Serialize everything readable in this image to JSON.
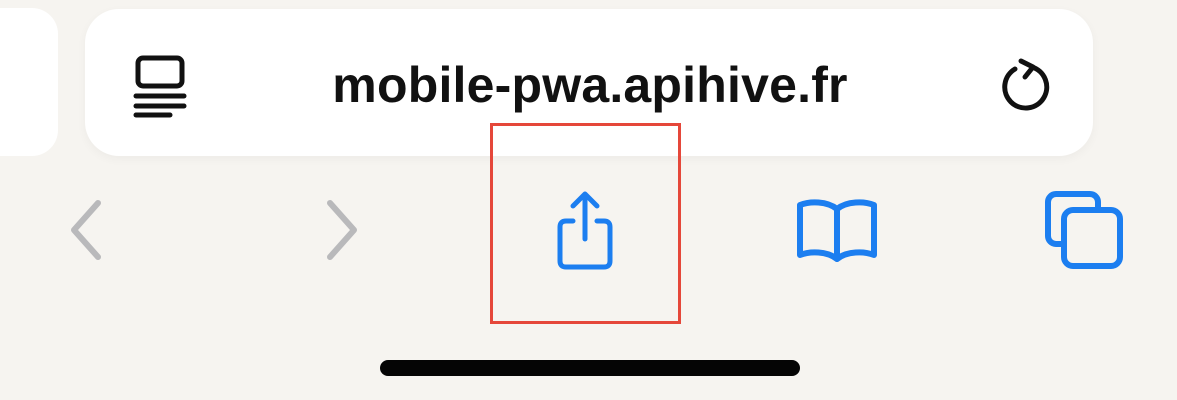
{
  "address_bar": {
    "url": "mobile-pwa.apihive.fr",
    "reader_icon": "reader-page-icon",
    "reload_icon": "reload-icon"
  },
  "toolbar": {
    "back": {
      "icon": "chevron-left-icon",
      "enabled": false
    },
    "forward": {
      "icon": "chevron-right-icon",
      "enabled": false
    },
    "share": {
      "icon": "share-icon",
      "highlighted": true
    },
    "bookmarks": {
      "icon": "book-icon"
    },
    "tabs": {
      "icon": "tabs-icon"
    }
  },
  "colors": {
    "accent": "#1c7ef0",
    "disabled": "#b9b9bb",
    "highlight_border": "#e5473a",
    "background": "#f6f4f0",
    "text": "#111111"
  }
}
